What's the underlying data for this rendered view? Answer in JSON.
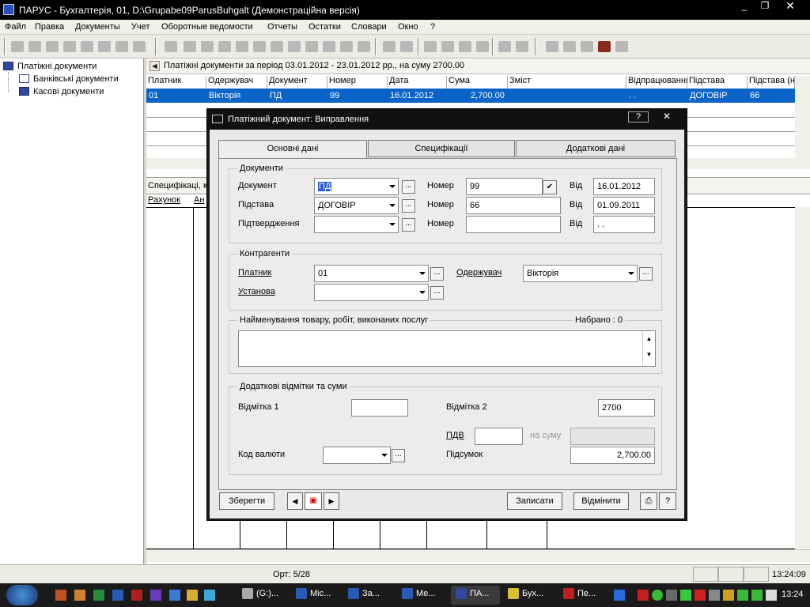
{
  "window": {
    "title": "ПАРУС - Бухгалтерія, 01, D:\\Grupabe09ParusBuhgalt (Демонстраційна версія)",
    "controls": [
      "_",
      "❐",
      "✕"
    ]
  },
  "menu": [
    "Файл",
    "Правка",
    "Документы",
    "Учет",
    "Оборотные ведомости",
    "Отчеты",
    "Остатки",
    "Словари",
    "Окно",
    "?"
  ],
  "tree": {
    "root": "Платіжні документи",
    "children": [
      "Банківські документи",
      "Касові документи"
    ]
  },
  "list": {
    "period": "Платіжні документи за період 03.01.2012 - 23.01.2012 рр., на суму 2700.00",
    "columns": [
      "Платник",
      "Одержувач",
      "Документ",
      "Номер",
      "Дата",
      "Сума",
      "Зміст",
      "Відпрацювання",
      "Підстава",
      "Підстава (н"
    ],
    "selected_row": [
      "01",
      "Вікторія",
      "ПД",
      "99",
      "16.01.2012",
      "2,700.00",
      "",
      ". .",
      "ДОГОВІР",
      "66"
    ]
  },
  "specs": {
    "label": "Специфікаці, к",
    "columns": [
      "Рахунок",
      "Ан"
    ]
  },
  "dialog": {
    "title": "Платіжний документ: Виправлення",
    "title_buttons": [
      "?",
      "✕"
    ],
    "tabs": [
      "Основні дані",
      "Специфікації",
      "Додаткові дані"
    ],
    "documents": {
      "group": "Документи",
      "rows": [
        {
          "label": "Документ",
          "value": "ПД",
          "num_label": "Номер",
          "num": "99",
          "date_label": "Від",
          "date": "16.01.2012"
        },
        {
          "label": "Підстава",
          "value": "ДОГОВІР",
          "num_label": "Номер",
          "num": "66",
          "date_label": "Від",
          "date": "01.09.2011"
        },
        {
          "label": "Підтвердження",
          "value": "",
          "num_label": "Номер",
          "num": "",
          "date_label": "Від",
          "date": " .  ."
        }
      ]
    },
    "counterparties": {
      "group": "Контрагенти",
      "payer_label": "Платник",
      "payer": "01",
      "inst_label": "Установа",
      "inst": "",
      "recipient_label": "Одержувач",
      "recipient": "Вікторія"
    },
    "goods": {
      "group": "Найменування товару, робіт, виконаних послуг",
      "count_label": "Набрано : 0"
    },
    "extra": {
      "group": "Додаткові відмітки та суми",
      "mark1_label": "Відмітка 1",
      "mark1": "",
      "mark2_label": "Відмітка 2",
      "mark2": "2700",
      "vat_label": "ПДВ",
      "vat": "",
      "vat_sum_label": "на суму",
      "vat_sum": "",
      "currency_label": "Код валюти",
      "currency": "",
      "total_label": "Підсумок",
      "total": "2,700.00"
    },
    "buttons": {
      "save": "Зберегти",
      "write": "Записати",
      "cancel": "Відмінити",
      "help": "?"
    },
    "ellipsis": "..."
  },
  "status": {
    "record": "Орт: 5/28",
    "time": "13:24:09"
  },
  "taskbar": {
    "items": [
      "(G:)...",
      "Mic...",
      "За...",
      "Ме...",
      "ПА...",
      "Бух...",
      "Пе..."
    ],
    "clock": "13:24"
  }
}
